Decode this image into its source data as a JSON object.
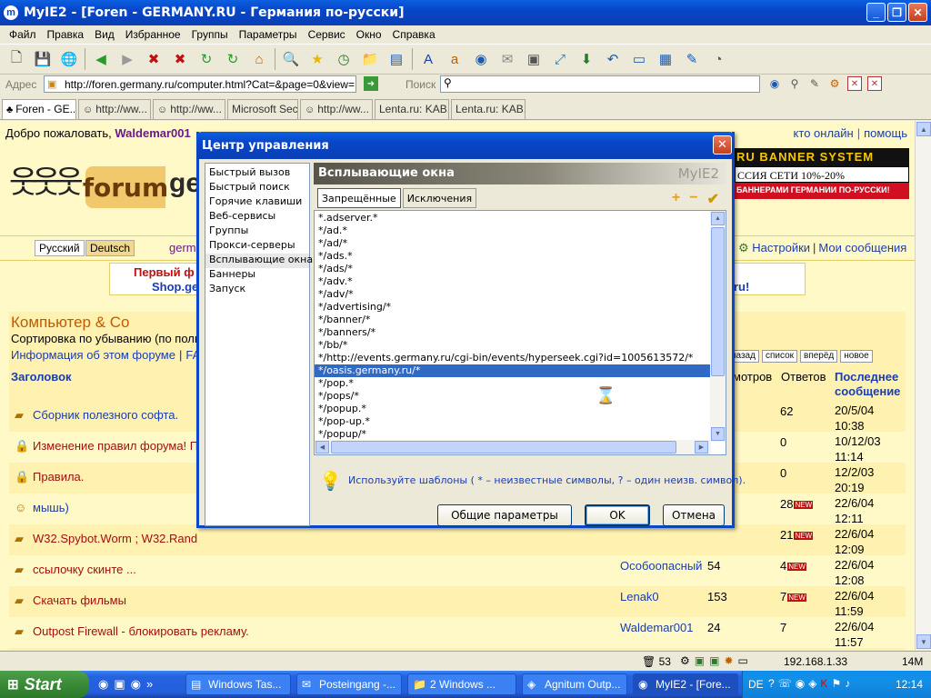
{
  "window": {
    "title": "MyIE2 - [Foren - GERMANY.RU - Германия по-русски]"
  },
  "menu": [
    "Файл",
    "Правка",
    "Вид",
    "Избранное",
    "Группы",
    "Параметры",
    "Сервис",
    "Окно",
    "Справка"
  ],
  "address": {
    "label": "Адрес",
    "url": "http://foren.germany.ru/computer.html?Cat=&page=0&view=",
    "search_label": "Поиск"
  },
  "tabs": [
    "Foren - GE...",
    "http://ww...",
    "http://ww...",
    "Microsoft Sec...",
    "http://ww...",
    "Lenta.ru: KAB...",
    "Lenta.ru: KAB..."
  ],
  "page": {
    "welcome_prefix": "Добро пожаловать,",
    "username": "Waldemar001",
    "online_link": "кто онлайн",
    "help_link": "помощь",
    "logo_text": "forum",
    "logo_tail": "ge",
    "banner": {
      "line1": "RU BANNER SYSTEM",
      "line2": "ССИЯ СЕТИ 10%-20%",
      "line3": "БАННЕРАМИ ГЕРМАНИИ ПО-РУССКИ!"
    },
    "lang_ru": "Русский",
    "lang_de": "Deutsch",
    "germ_link": "germ",
    "settings_link": "Настройки",
    "messages_link": "Мои сообщения",
    "promo_line1": "Первый ф",
    "promo_line2": "Shop.ge",
    "promo_tail": "ru!",
    "forum_title": "Компьютер & Co",
    "sort_text": "Сортировка по убыванию (по полн",
    "info_link": "Информация об этом форуме",
    "faq_link": "FA",
    "nav_buttons": [
      "назад",
      "список",
      "вперёд",
      "новое"
    ],
    "col_title": "Заголовок",
    "col_views": "мотров",
    "col_replies": "Ответов",
    "col_last_1": "Последнее",
    "col_last_2": "сообщение",
    "rows": [
      {
        "title": "Сборник полезного софта.",
        "author": "",
        "views": "",
        "replies": "62",
        "new": "",
        "date": "20/5/04",
        "time": "10:38"
      },
      {
        "title": "Изменение правил форума! Пр",
        "author": "",
        "views": "",
        "replies": "0",
        "new": "",
        "date": "10/12/03",
        "time": "11:14"
      },
      {
        "title": "Правила.",
        "author": "",
        "views": "",
        "replies": "0",
        "new": "",
        "date": "12/2/03",
        "time": "20:19"
      },
      {
        "title": "мышь)",
        "author": "",
        "views": "",
        "replies": "28",
        "new": "NEW",
        "date": "22/6/04",
        "time": "12:11"
      },
      {
        "title": "W32.Spybot.Worm ; W32.Rand",
        "author": "",
        "views": "",
        "replies": "21",
        "new": "NEW",
        "date": "22/6/04",
        "time": "12:09"
      },
      {
        "title": "ссылочку скинте ...",
        "author": "Особоопасный",
        "views": "54",
        "replies": "4",
        "new": "NEW",
        "date": "22/6/04",
        "time": "12:08"
      },
      {
        "title": "Скачать фильмы",
        "author": "Lenak0",
        "views": "153",
        "replies": "7",
        "new": "NEW",
        "date": "22/6/04",
        "time": "11:59"
      },
      {
        "title": "Outpost Firewall - блокировать рекламу.",
        "author": "Waldemar001",
        "views": "24",
        "replies": "7",
        "new": "",
        "date": "22/6/04",
        "time": "11:57"
      }
    ]
  },
  "dialog": {
    "title": "Центр управления",
    "sidebar": [
      "Быстрый вызов",
      "Быстрый поиск",
      "Горячие клавиши",
      "Веб-сервисы",
      "Группы",
      "Прокси-серверы",
      "Всплывающие окна",
      "Баннеры",
      "Запуск"
    ],
    "pane_title": "Всплывающие окна",
    "pane_brand": "MyIE2",
    "tab_blocked": "Запрещённые",
    "tab_exceptions": "Исключения",
    "list": [
      "*.adserver.*",
      "*/ad.*",
      "*/ad/*",
      "*/ads.*",
      "*/ads/*",
      "*/adv.*",
      "*/adv/*",
      "*/advertising/*",
      "*/banner/*",
      "*/banners/*",
      "*/bb/*",
      "*/http://events.germany.ru/cgi-bin/events/hyperseek.cgi?id=1005613572/*",
      "*/oasis.germany.ru/*",
      "*/pop.*",
      "*/pops/*",
      "*/popup.*",
      "*/pop-up.*",
      "*/popup/*"
    ],
    "hint": "Используйте шаблоны ( * – неизвестные символы, ? – один неизв. символ).",
    "btn_general": "Общие параметры",
    "btn_ok": "OK",
    "btn_cancel": "Отмена"
  },
  "status": {
    "count": "53",
    "ip": "192.168.1.33",
    "mem": "14M"
  },
  "taskbar": {
    "start": "Start",
    "tasks": [
      "Windows Tas...",
      "Posteingang -...",
      "2 Windows ...",
      "Agnitum Outp...",
      "MyIE2 - [Fore..."
    ],
    "lang": "DE",
    "clock": "12:14"
  }
}
